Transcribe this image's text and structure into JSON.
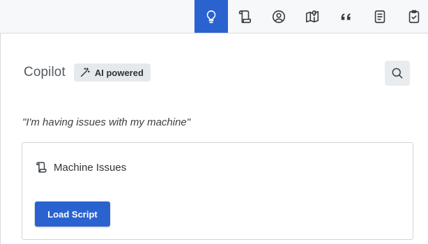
{
  "toolbar": {
    "buttons": [
      {
        "icon": "lightbulb-icon",
        "active": true
      },
      {
        "icon": "script-scroll-icon",
        "active": false
      },
      {
        "icon": "user-circle-icon",
        "active": false
      },
      {
        "icon": "map-pin-icon",
        "active": false
      },
      {
        "icon": "quote-icon",
        "active": false
      },
      {
        "icon": "document-icon",
        "active": false
      },
      {
        "icon": "clipboard-check-icon",
        "active": false
      }
    ],
    "accent_color": "#2a62d0"
  },
  "header": {
    "title": "Copilot",
    "badge_label": "AI powered",
    "badge_icon": "magic-wand-icon",
    "search_icon": "search-icon"
  },
  "query_text": "\"I'm having issues with my machine\"",
  "card": {
    "icon": "script-scroll-icon",
    "title": "Machine Issues",
    "button_label": "Load Script"
  }
}
